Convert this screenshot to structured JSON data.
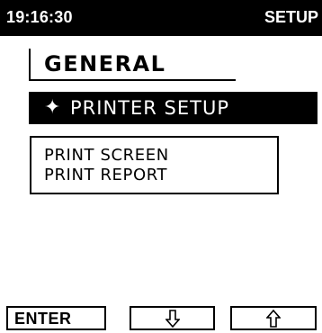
{
  "header": {
    "time": "19:16:30",
    "mode": "SETUP"
  },
  "section": {
    "title": "GENERAL"
  },
  "menu": {
    "selected_item": {
      "icon": "four-point-star-selector-icon",
      "glyph": "✦",
      "label": "PRINTER SETUP"
    }
  },
  "submenu": {
    "items": [
      "PRINT SCREEN",
      "PRINT REPORT"
    ]
  },
  "softkeys": {
    "enter_label": "ENTER",
    "down_icon": "arrow-down-outline-icon",
    "up_icon": "arrow-up-outline-icon"
  },
  "colors": {
    "foreground": "#000000",
    "background": "#ffffff"
  }
}
